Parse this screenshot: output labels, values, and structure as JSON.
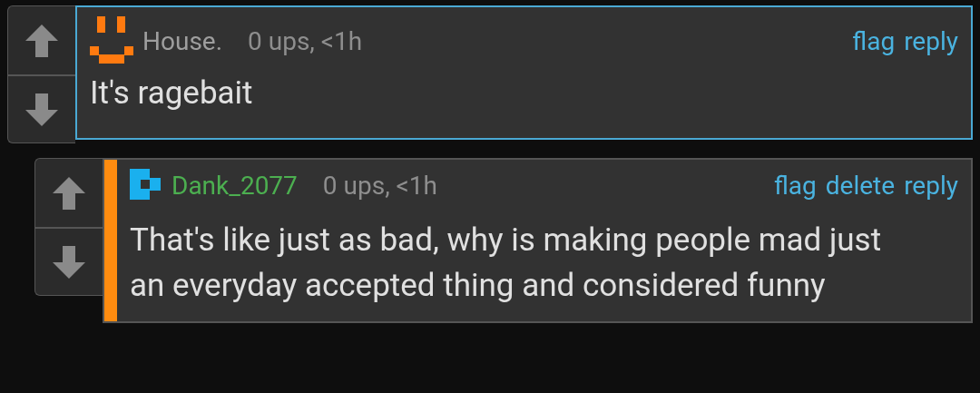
{
  "comments": [
    {
      "kind": "top",
      "highlighted": true,
      "avatar": {
        "kind": "smiley"
      },
      "author": {
        "name": "House.",
        "color": "#9e9e9e"
      },
      "meta": "0 ups, <1h",
      "actions": [
        "flag",
        "reply"
      ],
      "text": "It's ragebait"
    },
    {
      "kind": "reply",
      "highlighted": false,
      "avatar": {
        "kind": "blocks"
      },
      "author": {
        "name": "Dank_2077",
        "color": "#4caf50"
      },
      "meta": "0 ups, <1h",
      "actions": [
        "flag",
        "delete",
        "reply"
      ],
      "text": "That's like just as bad, why is making people mad just an everyday accepted thing and considered funny"
    }
  ]
}
